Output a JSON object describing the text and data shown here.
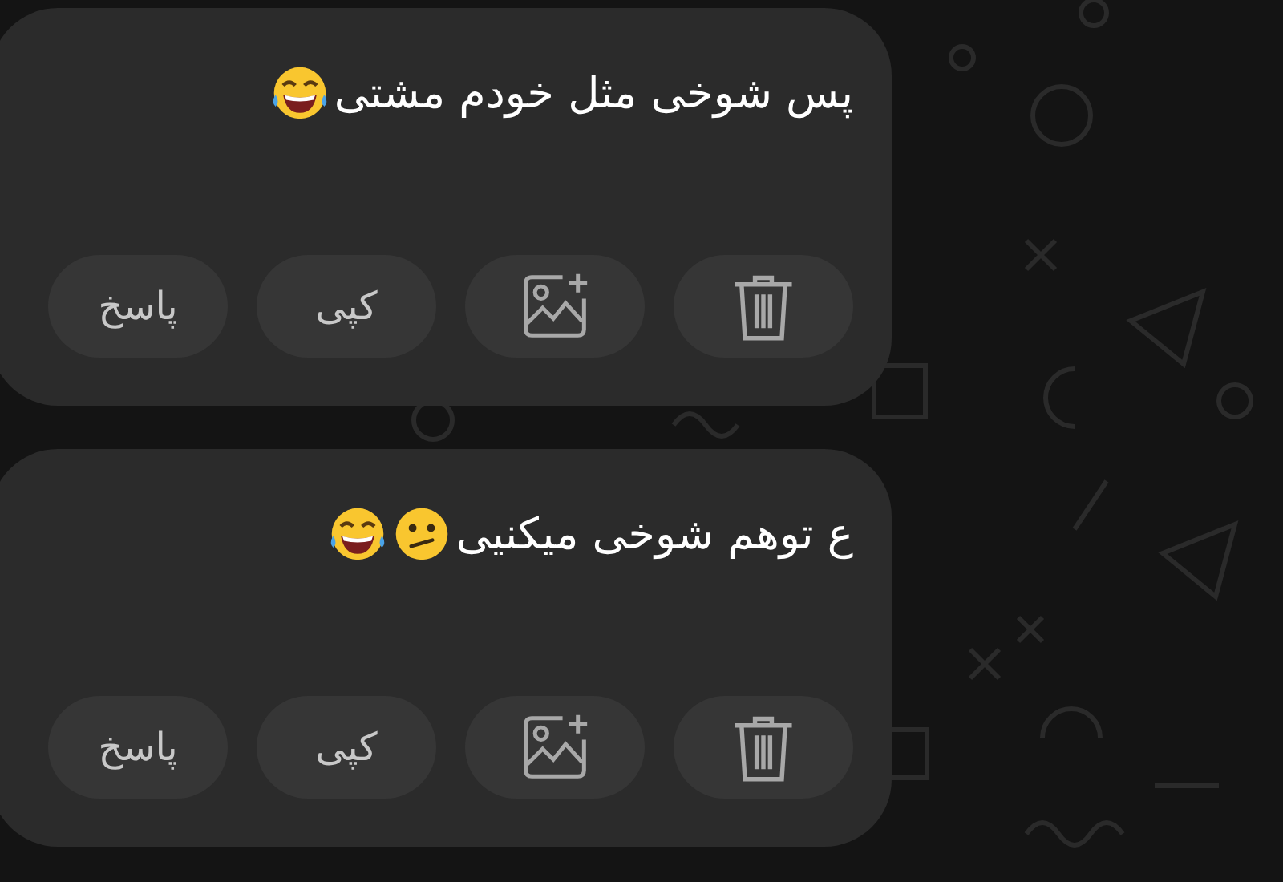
{
  "messages": [
    {
      "text": "پس شوخی مثل خودم مشتی",
      "emoji": [
        {
          "kind": "tears-of-joy"
        }
      ],
      "actions": [
        {
          "kind": "delete"
        },
        {
          "kind": "add-image"
        },
        {
          "kind": "text",
          "label": "کپی"
        },
        {
          "kind": "text",
          "label": "پاسخ"
        }
      ]
    },
    {
      "text": "ع توهم شوخی میکنیی",
      "emoji": [
        {
          "kind": "confused"
        },
        {
          "kind": "tears-of-joy"
        }
      ],
      "actions": [
        {
          "kind": "delete"
        },
        {
          "kind": "add-image"
        },
        {
          "kind": "text",
          "label": "کپی"
        },
        {
          "kind": "text",
          "label": "پاسخ"
        }
      ]
    }
  ]
}
